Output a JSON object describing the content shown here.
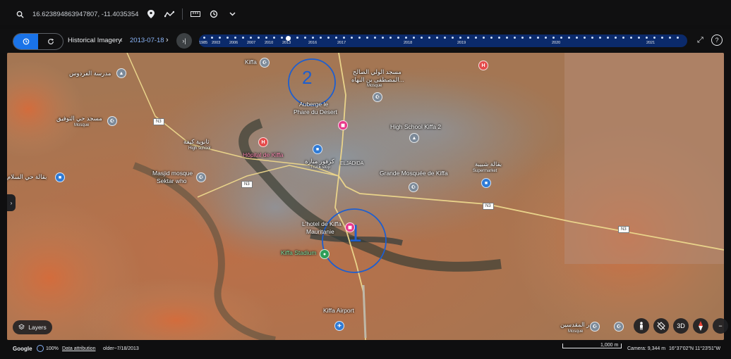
{
  "search": {
    "coords": "16.623894863947807, -11.4035354"
  },
  "toolbar": {
    "icons": [
      "search-icon",
      "location-pin-icon",
      "path-icon",
      "ruler-icon",
      "history-icon",
      "chevron-down-icon"
    ]
  },
  "history": {
    "label": "Historical Imagery",
    "date": "2013-07-18",
    "prev": "‹",
    "next": "›",
    "last": "›|",
    "years": [
      "1985",
      "2003",
      "2006",
      "2007",
      "2010",
      "2013",
      "2016",
      "2017",
      "2018",
      "2019",
      "2020",
      "2021"
    ],
    "selected_year": "2013"
  },
  "map": {
    "labels": {
      "kiffa": "Kiffa",
      "madrasa": "مدرسة الفردوس",
      "mosque_tawfiq": "مسجد حي التوفيق",
      "mosque_tawfiq_sub": "Mosque",
      "mosque_salih": "مسجد الولي الصالح",
      "mosque_salih_2": "المصطفى بن النهاه...",
      "mosque_salih_sub": "Mosque",
      "auberge": "Auberge le",
      "auberge_2": "Phare du Desert",
      "high_school_ar": "ثانوية كيفة",
      "high_school_sub": "High school",
      "hopital": "Hôpital de Kiffa",
      "truck": "كرفور مبارة",
      "truck_sub": "Truck stop",
      "eljadida": "ELJADIDA",
      "hs_kiffa": "High School Kiffa 2",
      "grande_mosquee": "Grande Mosquée de Kiffa",
      "supermarket": "بقالة شبيبة",
      "supermarket_sub": "Supermarket",
      "masjid1": "Masjid mosque",
      "masjid2": "Sektar who",
      "shop_salam": "بقالة حي السلام",
      "hotel1": "L'hotel de Kiffa",
      "hotel2": "Mauritanie",
      "stadium": "Kiffa Stadium",
      "airport": "Kiffa Airport",
      "mosque_bottom": "بدر المقدسين",
      "mosque_bottom_sub": "Mosque",
      "annot1": "1",
      "annot2": "2"
    },
    "road_shields": [
      "N3",
      "N3",
      "N3",
      "N3"
    ]
  },
  "controls": {
    "layers": "Layers",
    "three_d": "3D",
    "zoom_out": "−"
  },
  "footer": {
    "google": "Google",
    "zoom": "100%",
    "attribution": "Data attribution",
    "imagery": "older~7/18/2013",
    "scale": "1,000 m",
    "camera": "Camera: 9,344 m",
    "coords": "16°37'02\"N 11°23'51\"W"
  }
}
